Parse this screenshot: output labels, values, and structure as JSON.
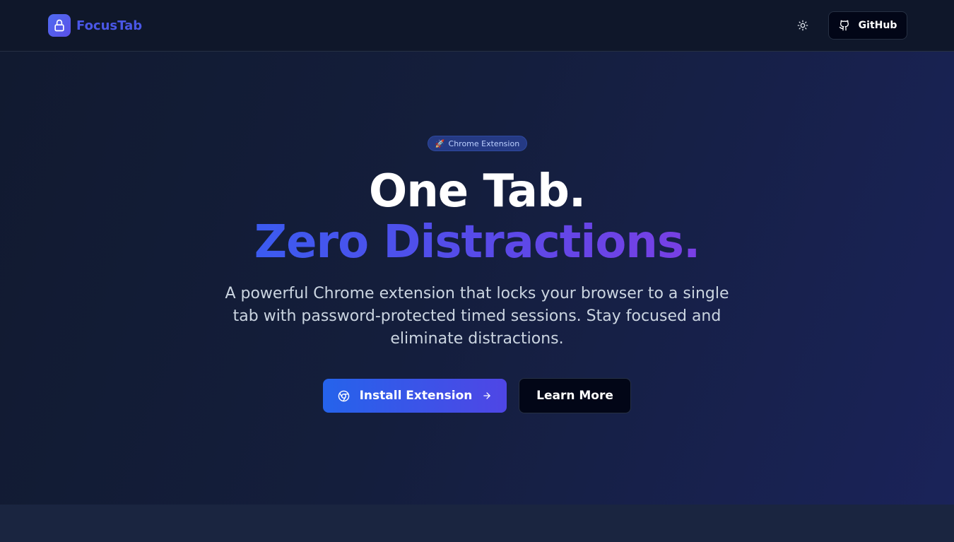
{
  "header": {
    "brand_name": "FocusTab",
    "github_label": "GitHub"
  },
  "hero": {
    "badge_emoji": "🚀",
    "badge_label": "Chrome Extension",
    "headline_line1": "One Tab.",
    "headline_line2": "Zero Distractions.",
    "subtitle": "A powerful Chrome extension that locks your browser to a single tab with password-protected timed sessions. Stay focused and eliminate distractions.",
    "install_label": "Install Extension",
    "learn_label": "Learn More"
  },
  "icons": {
    "brand": "lock-icon",
    "theme": "sun-icon",
    "github": "github-icon",
    "install": "chrome-icon",
    "install_arrow": "arrow-right-icon"
  },
  "colors": {
    "brand_text": "#4a57e6",
    "accent_start": "#2563eb",
    "accent_end": "#4f46e5",
    "badge_bg": "#253a84",
    "badge_text": "#bcd0ff"
  }
}
